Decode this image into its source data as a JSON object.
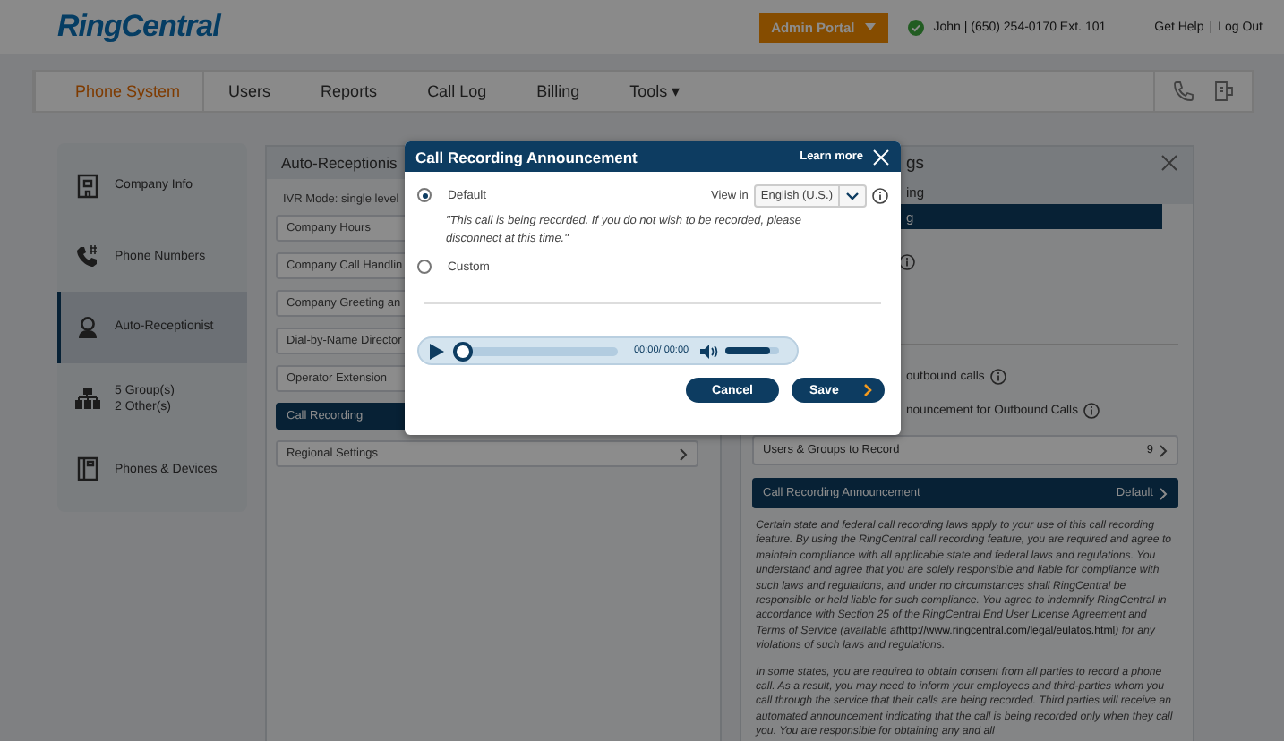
{
  "header": {
    "logo": "RingCentral",
    "admin_button": "Admin Portal",
    "user": "John | (650) 254-0170 Ext. 101",
    "links": [
      {
        "label": "Get Help"
      },
      {
        "label": "Log Out"
      }
    ],
    "separator": "|"
  },
  "nav": {
    "tabs": [
      {
        "label": "Phone System",
        "selected": true
      },
      {
        "label": "Users",
        "selected": false
      },
      {
        "label": "Reports",
        "selected": false
      },
      {
        "label": "Call Log",
        "selected": false
      },
      {
        "label": "Billing",
        "selected": false
      },
      {
        "label": "Tools ▾",
        "selected": false
      }
    ]
  },
  "sidebar": {
    "items": [
      {
        "lines": [
          "Company Info"
        ],
        "selected": false
      },
      {
        "lines": [
          "Phone Numbers"
        ],
        "selected": false
      },
      {
        "lines": [
          "Auto-Receptionist"
        ],
        "selected": true
      },
      {
        "lines": [
          "5 Group(s)",
          "2 Other(s)"
        ],
        "selected": false
      },
      {
        "lines": [
          "Phones & Devices"
        ],
        "selected": false
      }
    ]
  },
  "middle_panel": {
    "title": "Auto-Receptionis",
    "mode": "IVR Mode: single level",
    "rows": [
      {
        "label": "Company Hours",
        "selected": false
      },
      {
        "label": "Company Call Handlin",
        "selected": false
      },
      {
        "label": "Company Greeting an",
        "selected": false
      },
      {
        "label": "Dial-by-Name Director",
        "selected": false
      },
      {
        "label": "Operator Extension",
        "selected": false
      },
      {
        "label": "Call Recording",
        "selected": true
      },
      {
        "label": "Regional Settings",
        "selected": false,
        "chevron": true
      }
    ]
  },
  "right_panel": {
    "title": "gs",
    "tab": "ing",
    "active_tab": "g",
    "options": [
      {
        "label": "outbound calls"
      },
      {
        "label": "nouncement for Outbound Calls"
      }
    ],
    "rows": [
      {
        "label": "Users & Groups to Record",
        "value": "9",
        "selected": false
      },
      {
        "label": "Call Recording Announcement",
        "value": "Default",
        "selected": true
      }
    ],
    "notice": [
      {
        "before": "Certain state and federal call recording laws apply to your use of this call recording feature. By using the RingCentral call recording feature, you are required and agree to maintain compliance with all applicable state and federal laws and regulations. You understand and agree that you are solely responsible and liable for compliance with such laws and regulations, and under no circumstances shall RingCentral be responsible or held liable for such compliance. You agree to indemnify RingCentral in accordance with Section 25 of the RingCentral End User License Agreement and Terms of Service (available at",
        "link": "http://www.ringcentral.com/legal/eulatos.html",
        "after": ") for any violations of such laws and regulations."
      },
      {
        "before": "In some states, you are required to obtain consent from all parties to record a phone call. As a result, you may need to inform your employees and third-parties whom you call through the service that their calls are being recorded. Third parties will receive an automated announcement indicating that the call is being recorded only when they call you. You are responsible for obtaining any and all"
      }
    ]
  },
  "modal": {
    "title": "Call Recording Announcement",
    "learn_more": "Learn more",
    "options": [
      {
        "label": "Default",
        "selected": true
      },
      {
        "label": "Custom",
        "selected": false
      }
    ],
    "view_in_label": "View in",
    "language": "English (U.S.)",
    "default_text": "\"This call is being recorded. If you do not wish to be recorded, please disconnect at this time.\"",
    "player": {
      "time": "00:00/ 00:00",
      "progress": {
        "level": 0
      },
      "volume": {
        "level": 0.85
      }
    },
    "buttons": [
      {
        "label": "Cancel",
        "kind": "cancel"
      },
      {
        "label": "Save",
        "kind": "save"
      }
    ]
  }
}
